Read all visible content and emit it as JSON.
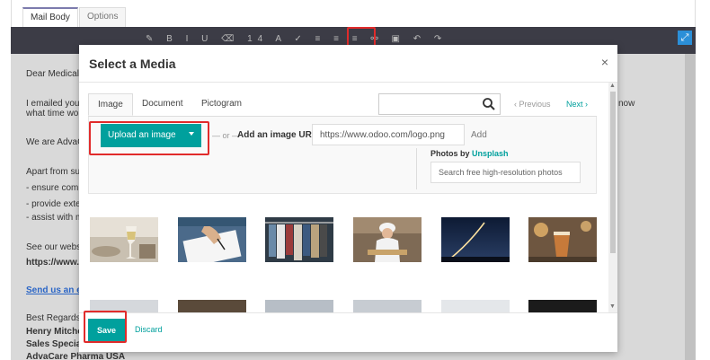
{
  "editor": {
    "tabs": [
      {
        "label": "Mail Body"
      },
      {
        "label": "Options"
      }
    ],
    "body_lines": [
      "Dear Medical",
      "I emailed you a",
      "what time wor",
      "We are AdvaC",
      "Apart from sup",
      "- ensure comp",
      "- provide exte",
      "- assist with m",
      "See our websi",
      "https://www.a",
      "Send us an e",
      "Best Regards",
      "Henry Mitche",
      "Sales Special",
      "AdvaCare Pharma USA"
    ],
    "right_fragment": "now"
  },
  "modal": {
    "title": "Select a Media",
    "close_label": "×",
    "tabs": [
      {
        "label": "Image"
      },
      {
        "label": "Document"
      },
      {
        "label": "Pictogram"
      }
    ],
    "search": {
      "value": "",
      "placeholder": ""
    },
    "pager": {
      "prev": "‹ Previous",
      "next": "Next ›"
    },
    "upload_button": "Upload an image",
    "or_text": "— or —",
    "url_label": "Add an image URL",
    "url_placeholder": "https://www.odoo.com/logo.png",
    "add_label": "Add",
    "photos_by": "Photos by",
    "unsplash": "Unsplash",
    "unsplash_placeholder": "Search free high-resolution photos",
    "footer": {
      "save": "Save",
      "discard": "Discard"
    }
  },
  "colors": {
    "accent": "#00a09d",
    "highlight": "#e12b2b",
    "toolbar": "#3c3c46"
  },
  "images": [
    {
      "subject": "wine glass on table"
    },
    {
      "subject": "hand writing on paper"
    },
    {
      "subject": "clothes rack"
    },
    {
      "subject": "woman with food tray"
    },
    {
      "subject": "rocket launch at night"
    },
    {
      "subject": "drink on table"
    }
  ]
}
